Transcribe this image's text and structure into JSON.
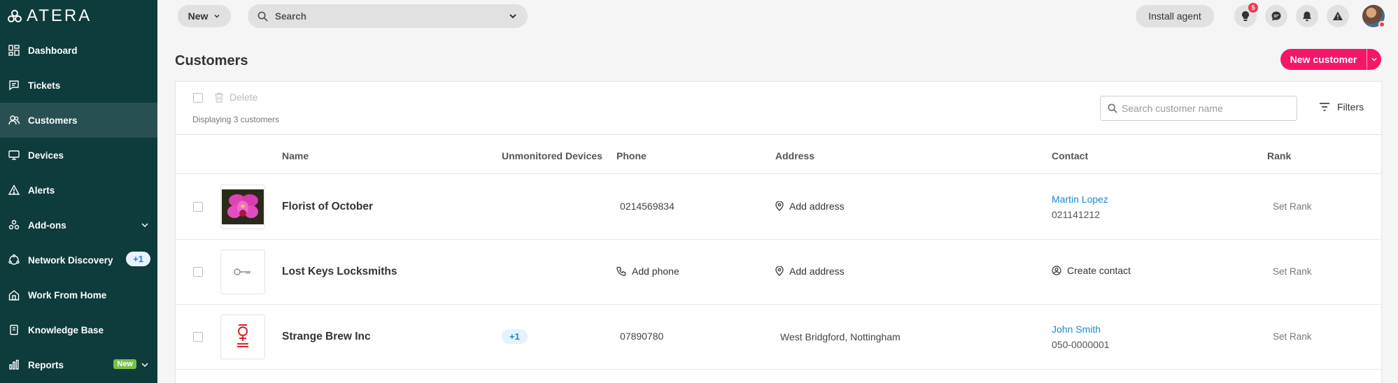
{
  "brand": {
    "logo_text": "ATERA"
  },
  "sidebar": {
    "items": [
      {
        "label": "Dashboard",
        "icon": "dashboard-icon"
      },
      {
        "label": "Tickets",
        "icon": "tickets-icon"
      },
      {
        "label": "Customers",
        "icon": "customers-icon",
        "active": true
      },
      {
        "label": "Devices",
        "icon": "devices-icon"
      },
      {
        "label": "Alerts",
        "icon": "alerts-icon"
      },
      {
        "label": "Add-ons",
        "icon": "addons-icon"
      },
      {
        "label": "Network Discovery",
        "icon": "network-discovery-icon",
        "badge": "+1"
      },
      {
        "label": "Work From Home",
        "icon": "home-icon"
      },
      {
        "label": "Knowledge Base",
        "icon": "knowledge-base-icon"
      },
      {
        "label": "Reports",
        "icon": "reports-icon",
        "badge": "New"
      }
    ]
  },
  "topbar": {
    "new_label": "New",
    "search_placeholder": "Search",
    "install_agent_label": "Install agent",
    "notification_count": "5"
  },
  "page": {
    "title": "Customers",
    "new_customer_label": "New customer"
  },
  "toolbar": {
    "delete_label": "Delete",
    "display_count": "Displaying 3 customers",
    "search_placeholder": "Search customer name",
    "filters_label": "Filters"
  },
  "table": {
    "columns": [
      "Name",
      "Unmonitored Devices",
      "Phone",
      "Address",
      "Contact",
      "Rank"
    ],
    "rows": [
      {
        "name": "Florist of October",
        "unmonitored": "",
        "phone": "0214569834",
        "address": "",
        "address_action": "Add address",
        "contact_name": "Martin Lopez",
        "contact_phone": "021141212",
        "rank": "Set Rank"
      },
      {
        "name": "Lost Keys Locksmiths",
        "unmonitored": "",
        "phone": "",
        "phone_action": "Add phone",
        "address": "",
        "address_action": "Add address",
        "contact_action": "Create contact",
        "rank": "Set Rank"
      },
      {
        "name": "Strange Brew Inc",
        "unmonitored": "+1",
        "phone": "07890780",
        "address": "West Bridgford, Nottingham",
        "contact_name": "John Smith",
        "contact_phone": "050-0000001",
        "rank": "Set Rank"
      }
    ]
  },
  "colors": {
    "sidebar_bg": "#0e3b3c",
    "sidebar_active": "#285052",
    "accent_pink": "#f5166a",
    "link_blue": "#1a8ad4",
    "badge_green": "#78c247"
  }
}
